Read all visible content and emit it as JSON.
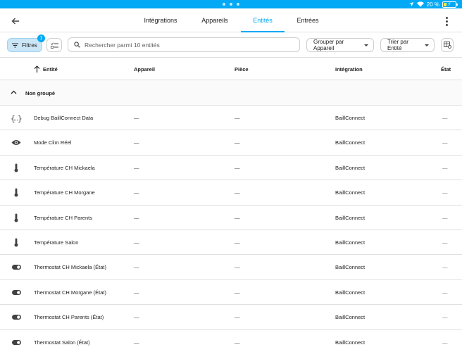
{
  "status_bar": {
    "battery_text": "20 %"
  },
  "tabs": [
    {
      "label": "Intégrations"
    },
    {
      "label": "Appareils"
    },
    {
      "label": "Entités"
    },
    {
      "label": "Entrées"
    }
  ],
  "toolbar": {
    "filters_label": "Filtres",
    "filters_badge": "1",
    "search_placeholder": "Rechercher parmi 10 entités",
    "group_label": "Grouper par Appareil",
    "sort_label": "Trier par Entité"
  },
  "columns": [
    "Entité",
    "Appareil",
    "Pièce",
    "Intégration",
    "État"
  ],
  "group": {
    "label": "Non groupé"
  },
  "rows": [
    {
      "icon": "braces-icon",
      "name": "Debug BaillConnect Data",
      "device": "—",
      "room": "—",
      "integration": "BaillConnect",
      "state": "—"
    },
    {
      "icon": "eye-icon",
      "name": "Mode Clim Réel",
      "device": "—",
      "room": "—",
      "integration": "BaillConnect",
      "state": "—"
    },
    {
      "icon": "thermometer-icon",
      "name": "Température CH Mickaela",
      "device": "—",
      "room": "—",
      "integration": "BaillConnect",
      "state": "—"
    },
    {
      "icon": "thermometer-icon",
      "name": "Température CH Morgane",
      "device": "—",
      "room": "—",
      "integration": "BaillConnect",
      "state": "—"
    },
    {
      "icon": "thermometer-icon",
      "name": "Température CH Parents",
      "device": "—",
      "room": "—",
      "integration": "BaillConnect",
      "state": "—"
    },
    {
      "icon": "thermometer-icon",
      "name": "Température Salon",
      "device": "—",
      "room": "—",
      "integration": "BaillConnect",
      "state": "—"
    },
    {
      "icon": "toggle-icon",
      "name": "Thermostat CH Mickaela (État)",
      "device": "—",
      "room": "—",
      "integration": "BaillConnect",
      "state": "—"
    },
    {
      "icon": "toggle-icon",
      "name": "Thermostat CH Morgane (État)",
      "device": "—",
      "room": "—",
      "integration": "BaillConnect",
      "state": "—"
    },
    {
      "icon": "toggle-icon",
      "name": "Thermostat CH Parents (État)",
      "device": "—",
      "room": "—",
      "integration": "BaillConnect",
      "state": "—"
    },
    {
      "icon": "toggle-icon",
      "name": "Thermostat Salon (État)",
      "device": "—",
      "room": "—",
      "integration": "BaillConnect",
      "state": "—"
    }
  ],
  "colors": {
    "accent": "#03a9f4",
    "filter_bg": "#cbe6f7"
  }
}
